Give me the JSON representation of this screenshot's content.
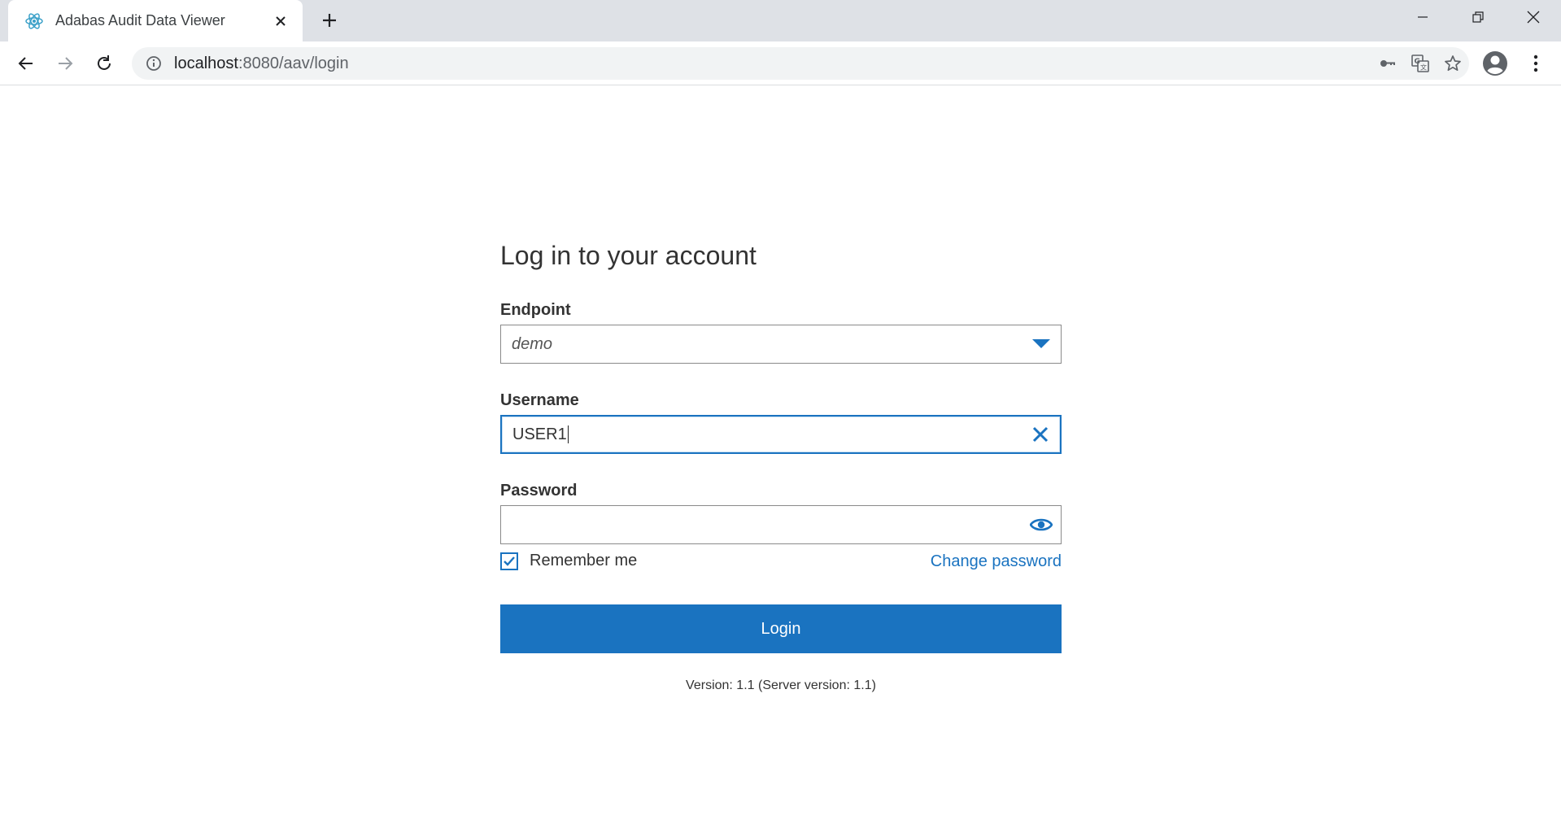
{
  "browser": {
    "tab_title": "Adabas Audit Data Viewer",
    "url_host": "localhost",
    "url_rest": ":8080/aav/login",
    "favicon": "react-atom-icon"
  },
  "login": {
    "title": "Log in to your account",
    "endpoint_label": "Endpoint",
    "endpoint_value": "demo",
    "username_label": "Username",
    "username_value": "USER1",
    "password_label": "Password",
    "password_value": "",
    "remember_label": "Remember me",
    "remember_checked": true,
    "change_password_label": "Change password",
    "login_button_label": "Login",
    "version_text": "Version: 1.1 (Server version: 1.1)"
  },
  "colors": {
    "accent": "#1a73c0",
    "tabstrip": "#dee1e6",
    "omnibox": "#f1f3f4"
  }
}
